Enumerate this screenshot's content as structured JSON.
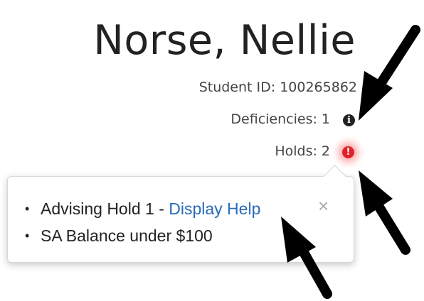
{
  "student": {
    "name": "Norse, Nellie",
    "id_label": "Student ID: 100265862",
    "deficiencies_label": "Deficiencies: 1",
    "holds_label": "Holds: 2"
  },
  "icons": {
    "info": "info-circle-icon",
    "alert": "exclamation-circle-icon"
  },
  "colors": {
    "alert_red": "#e0212a",
    "link_blue": "#2a6bb8",
    "arrow": "#000000"
  },
  "popover": {
    "items": [
      {
        "text": "Advising Hold 1 - ",
        "link": "Display Help"
      },
      {
        "text": "SA Balance under $100"
      }
    ],
    "close_glyph": "×"
  }
}
